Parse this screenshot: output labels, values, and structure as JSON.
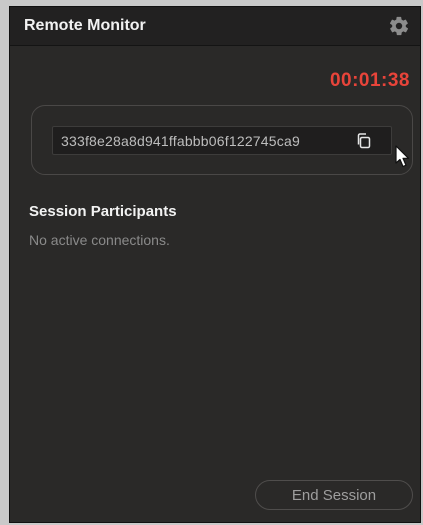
{
  "window": {
    "title": "Remote Monitor",
    "settings_icon": "gear-icon"
  },
  "session": {
    "timer": "00:01:38",
    "session_id": "333f8e28a8d941ffabbb06f122745ca9",
    "copy_icon": "copy-icon"
  },
  "participants": {
    "heading": "Session Participants",
    "empty_message": "No active connections."
  },
  "actions": {
    "end_session_label": "End Session"
  },
  "colors": {
    "timer": "#e8443a",
    "panel_bg": "#2a2928",
    "titlebar_bg": "#222121"
  }
}
